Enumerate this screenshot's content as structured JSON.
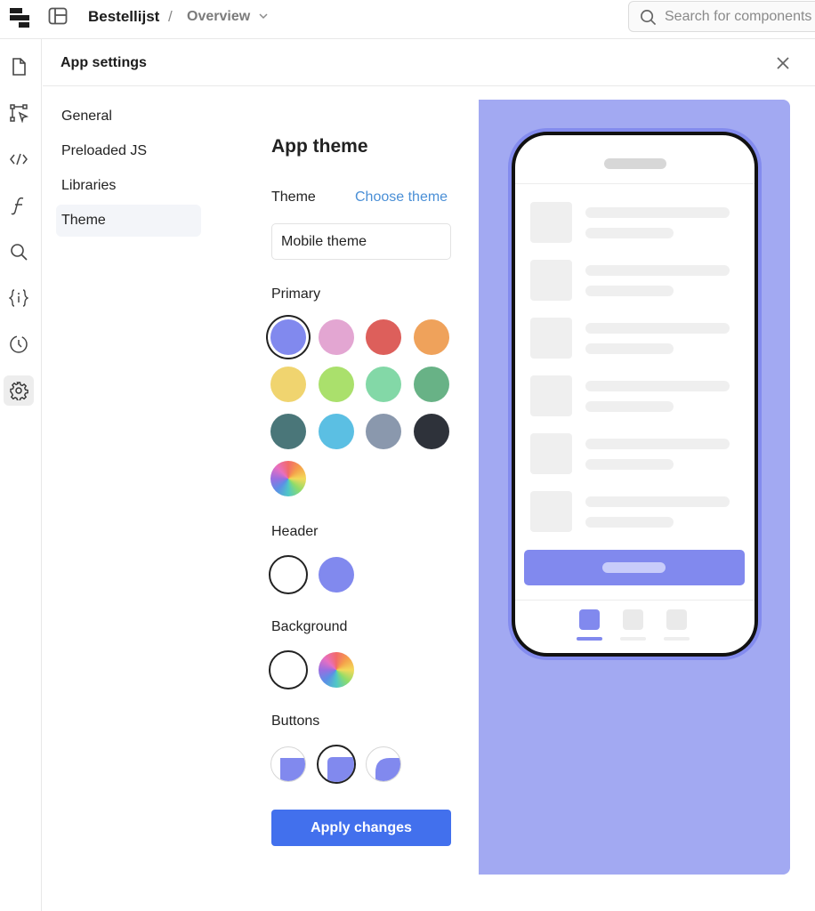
{
  "topbar": {
    "app_name": "Bestellijst",
    "separator": "/",
    "page_name": "Overview",
    "search_placeholder": "Search for components"
  },
  "rail": {
    "items": [
      {
        "icon": "page-icon",
        "active": false
      },
      {
        "icon": "workflow-icon",
        "active": false
      },
      {
        "icon": "code-icon",
        "active": false
      },
      {
        "icon": "function-icon",
        "active": false
      },
      {
        "icon": "search-icon",
        "active": false
      },
      {
        "icon": "variables-icon",
        "active": false
      },
      {
        "icon": "history-icon",
        "active": false
      },
      {
        "icon": "settings-icon",
        "active": true
      }
    ]
  },
  "settings": {
    "title": "App settings",
    "nav": [
      {
        "label": "General",
        "active": false
      },
      {
        "label": "Preloaded JS",
        "active": false
      },
      {
        "label": "Libraries",
        "active": false
      },
      {
        "label": "Theme",
        "active": true
      }
    ]
  },
  "theme_panel": {
    "heading": "App theme",
    "theme_label": "Theme",
    "choose_theme": "Choose theme",
    "current_theme": "Mobile theme",
    "primary_label": "Primary",
    "primary_colors": [
      "#8189ee",
      "#e3a6d2",
      "#dd5f5b",
      "#efa25b",
      "#f0d46f",
      "#aae06c",
      "#83d8a7",
      "#68b286",
      "#4a7679",
      "#5bbfe3",
      "#8a98ad",
      "#2e323a",
      "rainbow"
    ],
    "primary_selected": 0,
    "header_label": "Header",
    "header_options": [
      "white",
      "#8189ee"
    ],
    "header_selected": 0,
    "background_label": "Background",
    "background_options": [
      "white",
      "rainbow"
    ],
    "background_selected": 0,
    "buttons_label": "Buttons",
    "button_shapes": [
      "square",
      "rounded",
      "pill"
    ],
    "buttons_selected": 1,
    "apply_label": "Apply changes"
  },
  "preview": {
    "background": "#a2a9f2",
    "accent": "#8189ee"
  }
}
